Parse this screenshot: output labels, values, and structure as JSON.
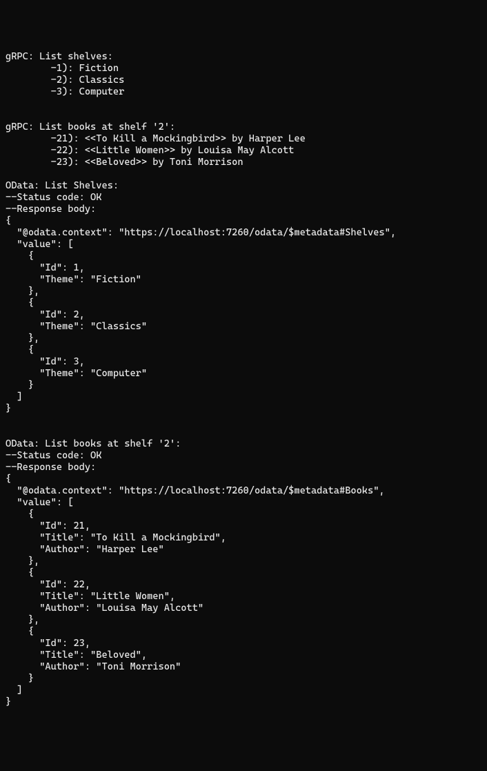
{
  "lines": [
    "gRPC: List shelves:",
    "        -1): Fiction",
    "        -2): Classics",
    "        -3): Computer",
    "",
    "",
    "gRPC: List books at shelf '2':",
    "        -21): <<To Kill a Mockingbird>> by Harper Lee",
    "        -22): <<Little Women>> by Louisa May Alcott",
    "        -23): <<Beloved>> by Toni Morrison",
    "",
    "OData: List Shelves:",
    "--Status code: OK",
    "--Response body:",
    "{",
    "  \"@odata.context\": \"https://localhost:7260/odata/$metadata#Shelves\",",
    "  \"value\": [",
    "    {",
    "      \"Id\": 1,",
    "      \"Theme\": \"Fiction\"",
    "    },",
    "    {",
    "      \"Id\": 2,",
    "      \"Theme\": \"Classics\"",
    "    },",
    "    {",
    "      \"Id\": 3,",
    "      \"Theme\": \"Computer\"",
    "    }",
    "  ]",
    "}",
    "",
    "",
    "OData: List books at shelf '2':",
    "--Status code: OK",
    "--Response body:",
    "{",
    "  \"@odata.context\": \"https://localhost:7260/odata/$metadata#Books\",",
    "  \"value\": [",
    "    {",
    "      \"Id\": 21,",
    "      \"Title\": \"To Kill a Mockingbird\",",
    "      \"Author\": \"Harper Lee\"",
    "    },",
    "    {",
    "      \"Id\": 22,",
    "      \"Title\": \"Little Women\",",
    "      \"Author\": \"Louisa May Alcott\"",
    "    },",
    "    {",
    "      \"Id\": 23,",
    "      \"Title\": \"Beloved\",",
    "      \"Author\": \"Toni Morrison\"",
    "    }",
    "  ]",
    "}"
  ],
  "grpc_shelves": [
    {
      "id": 1,
      "theme": "Fiction"
    },
    {
      "id": 2,
      "theme": "Classics"
    },
    {
      "id": 3,
      "theme": "Computer"
    }
  ],
  "grpc_books_shelf_2": [
    {
      "id": 21,
      "title": "To Kill a Mockingbird",
      "author": "Harper Lee"
    },
    {
      "id": 22,
      "title": "Little Women",
      "author": "Louisa May Alcott"
    },
    {
      "id": 23,
      "title": "Beloved",
      "author": "Toni Morrison"
    }
  ],
  "odata_shelves": {
    "status_code": "OK",
    "context": "https://localhost:7260/odata/$metadata#Shelves",
    "value": [
      {
        "Id": 1,
        "Theme": "Fiction"
      },
      {
        "Id": 2,
        "Theme": "Classics"
      },
      {
        "Id": 3,
        "Theme": "Computer"
      }
    ]
  },
  "odata_books_shelf_2": {
    "status_code": "OK",
    "context": "https://localhost:7260/odata/$metadata#Books",
    "value": [
      {
        "Id": 21,
        "Title": "To Kill a Mockingbird",
        "Author": "Harper Lee"
      },
      {
        "Id": 22,
        "Title": "Little Women",
        "Author": "Louisa May Alcott"
      },
      {
        "Id": 23,
        "Title": "Beloved",
        "Author": "Toni Morrison"
      }
    ]
  }
}
